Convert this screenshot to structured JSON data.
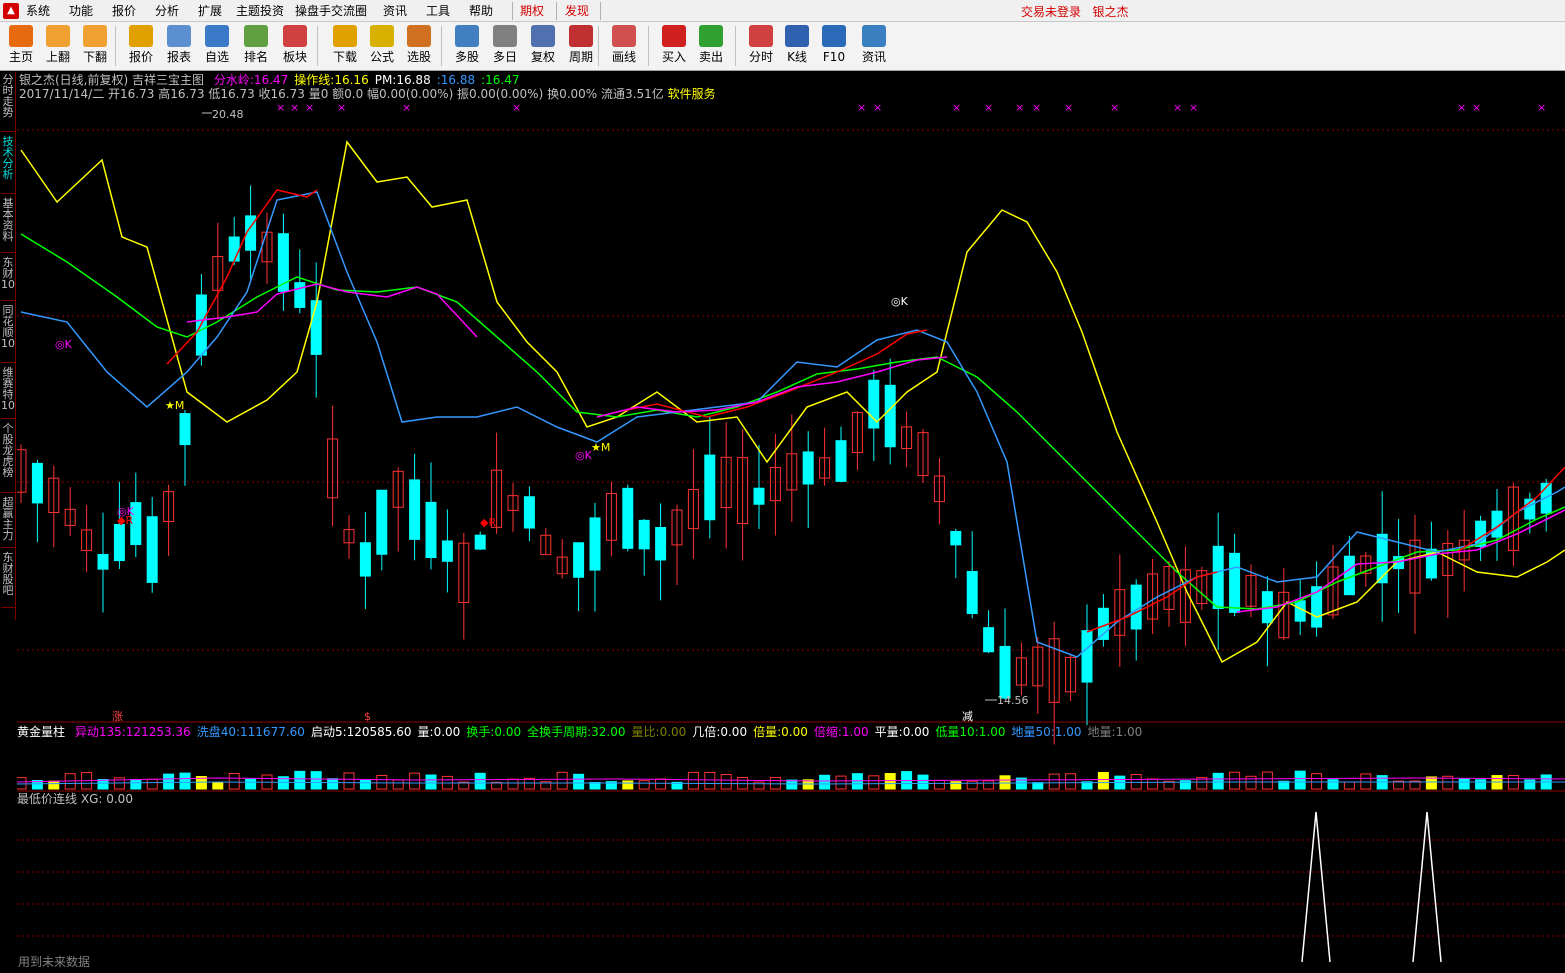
{
  "menu": {
    "items": [
      "系统",
      "功能",
      "报价",
      "分析",
      "扩展",
      "主题投资",
      "操盘手交流圈",
      "资讯",
      "工具",
      "帮助"
    ],
    "highlight_items": [
      "期权",
      "发现"
    ],
    "status": "交易未登录",
    "brand": "银之杰"
  },
  "toolbar": {
    "buttons": [
      {
        "label": "主页",
        "icon": "home-icon"
      },
      {
        "label": "上翻",
        "icon": "page-up-icon"
      },
      {
        "label": "下翻",
        "icon": "page-down-icon"
      },
      {
        "label": "报价",
        "icon": "quote-icon"
      },
      {
        "label": "报表",
        "icon": "report-icon"
      },
      {
        "label": "自选",
        "icon": "favorites-icon"
      },
      {
        "label": "排名",
        "icon": "ranking-icon"
      },
      {
        "label": "板块",
        "icon": "sector-icon"
      },
      {
        "label": "下载",
        "icon": "download-icon"
      },
      {
        "label": "公式",
        "icon": "formula-icon"
      },
      {
        "label": "选股",
        "icon": "stock-picker-icon"
      },
      {
        "label": "多股",
        "icon": "multi-stock-icon"
      },
      {
        "label": "多日",
        "icon": "multi-day-icon"
      },
      {
        "label": "复权",
        "icon": "adjust-icon"
      },
      {
        "label": "周期",
        "icon": "period-icon"
      },
      {
        "label": "画线",
        "icon": "draw-line-icon"
      },
      {
        "label": "买入",
        "icon": "buy-icon"
      },
      {
        "label": "卖出",
        "icon": "sell-icon"
      },
      {
        "label": "分时",
        "icon": "intraday-icon"
      },
      {
        "label": "K线",
        "icon": "kline-icon"
      },
      {
        "label": "F10",
        "icon": "f10-icon"
      },
      {
        "label": "资讯",
        "icon": "news-icon"
      }
    ]
  },
  "side_tabs": [
    "分时走势",
    "技术分析",
    "基本资料",
    "东财10",
    "同花顺10",
    "维赛特10",
    "个股龙虎榜",
    "超赢主力",
    "东财股吧"
  ],
  "main_panel": {
    "title": "银之杰(日线,前复权)",
    "indicator_name": "吉祥三宝主图",
    "fields": [
      {
        "label": "分水岭",
        "value": "16.47",
        "color": "#ff00ff"
      },
      {
        "label": "操作线",
        "value": "16.16",
        "color": "#ffff00"
      },
      {
        "label": "PM",
        "value": "16.88",
        "color": "#ffffff"
      },
      {
        "label": "",
        "value": "16.88",
        "color": "#3399ff"
      },
      {
        "label": "",
        "value": "16.47",
        "color": "#00ff00"
      }
    ],
    "quote_line": "2017/11/14/二 开16.73 高16.73 低16.73 收16.73 量0 额0.0 幅0.00(0.00%) 振0.00(0.00%) 换0.00% 流通3.51亿",
    "service_link": "软件服务",
    "max_price_label": "20.48",
    "min_price_label": "14.56",
    "markers": [
      "◎K",
      "R",
      "M"
    ],
    "bottom_tags": [
      "涨",
      "$",
      "减"
    ]
  },
  "volume_panel": {
    "title": "黄金量柱",
    "fields": [
      {
        "label": "异动135",
        "value": "121253.36",
        "color": "#ff00ff"
      },
      {
        "label": "洗盘40",
        "value": "111677.60",
        "color": "#3399ff"
      },
      {
        "label": "启动5",
        "value": "120585.60",
        "color": "#ffffff"
      },
      {
        "label": "量",
        "value": "0.00",
        "color": "#ffffff"
      },
      {
        "label": "换手",
        "value": "0.00",
        "color": "#00ff00"
      },
      {
        "label": "全换手周期",
        "value": "32.00",
        "color": "#00ff00"
      },
      {
        "label": "量比",
        "value": "0.00",
        "color": "#808000"
      },
      {
        "label": "几倍",
        "value": "0.00",
        "color": "#ffffff"
      },
      {
        "label": "倍量",
        "value": "0.00",
        "color": "#ffff00"
      },
      {
        "label": "倍缩",
        "value": "1.00",
        "color": "#ff00ff"
      },
      {
        "label": "平量",
        "value": "0.00",
        "color": "#ffffff"
      },
      {
        "label": "低量10",
        "value": "1.00",
        "color": "#00ff00"
      },
      {
        "label": "地量50",
        "value": "1.00",
        "color": "#3399ff"
      },
      {
        "label": "地量",
        "value": "1.00",
        "color": "#808080"
      }
    ]
  },
  "xg_panel": {
    "title": "最低价连线",
    "field": {
      "label": "XG",
      "value": "0.00"
    },
    "footer": "用到未来数据"
  },
  "colors": {
    "up": "#ff3232",
    "down": "#00ffff",
    "ma_yellow": "#ffff00",
    "ma_green": "#00ff00",
    "ma_blue": "#3399ff",
    "ma_red": "#ff0000",
    "ma_magenta": "#ff00ff",
    "grid": "#8b0000"
  }
}
